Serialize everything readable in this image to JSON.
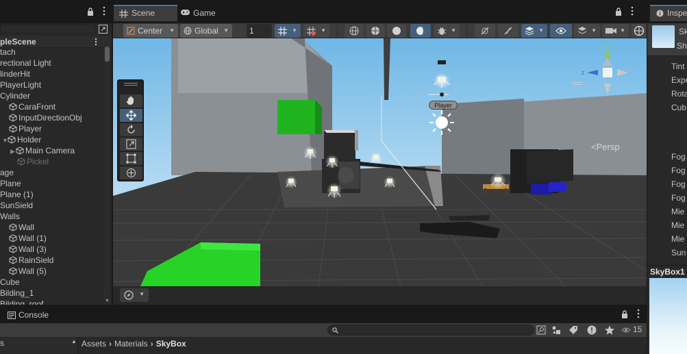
{
  "hierarchy": {
    "scene_name": "pleScene",
    "items": [
      {
        "label": "tach",
        "icon": "none"
      },
      {
        "label": "rectional Light",
        "icon": "none"
      },
      {
        "label": "linderHit",
        "icon": "none"
      },
      {
        "label": "PlayerLight",
        "icon": "none"
      },
      {
        "label": "Cylinder",
        "icon": "none"
      },
      {
        "label": "CaraFront",
        "icon": "cube-icon"
      },
      {
        "label": "InputDirectionObj",
        "icon": "cube-icon"
      },
      {
        "label": "Player",
        "icon": "cube-icon"
      },
      {
        "label": "Holder",
        "icon": "cube-icon"
      },
      {
        "label": "Main Camera",
        "icon": "cube-icon"
      },
      {
        "label": "Pickel",
        "icon": "cube-icon"
      },
      {
        "label": "age",
        "icon": "none"
      },
      {
        "label": "Plane",
        "icon": "none"
      },
      {
        "label": "Plane (1)",
        "icon": "none"
      },
      {
        "label": "SunSield",
        "icon": "none"
      },
      {
        "label": "Walls",
        "icon": "none"
      },
      {
        "label": "Wall",
        "icon": "cube-icon"
      },
      {
        "label": "Wall (1)",
        "icon": "cube-icon"
      },
      {
        "label": "Wall (3)",
        "icon": "cube-icon"
      },
      {
        "label": "RainSield",
        "icon": "cube-icon"
      },
      {
        "label": "Wall (5)",
        "icon": "cube-icon"
      },
      {
        "label": "Cube",
        "icon": "none"
      },
      {
        "label": "Bilding_1",
        "icon": "none"
      },
      {
        "label": "Bilding_roof",
        "icon": "none"
      }
    ]
  },
  "tabs": {
    "scene": "Scene",
    "game": "Game"
  },
  "toolbar": {
    "pivot": "Center",
    "space": "Global",
    "snap_value": "1"
  },
  "viewport": {
    "persp_label": "<Persp",
    "player_tag": "Player",
    "sky_colors": [
      "#7fbfe8",
      "#b7dcf3"
    ],
    "ground_color": "#3a3a3a"
  },
  "inspector": {
    "tab_label": "Inspe",
    "object_name": "Sk",
    "shader_label": "Sh",
    "properties": [
      "Tint",
      "Expo",
      "Rota",
      "Cub",
      "Fog",
      "Fog",
      "Fog",
      "Fog",
      "Mie",
      "Mie",
      "Mie",
      "Sun"
    ],
    "preview_label": "SkyBox1"
  },
  "console": {
    "tab_label": "Console",
    "left_label": "s",
    "count": "15",
    "breadcrumb": [
      "Assets",
      "Materials",
      "SkyBox"
    ]
  }
}
